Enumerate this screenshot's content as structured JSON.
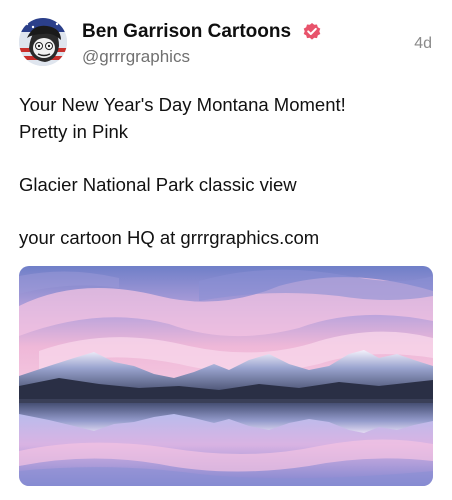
{
  "post": {
    "author": {
      "name": "Ben Garrison Cartoons",
      "handle": "@grrrgraphics",
      "verified": true,
      "avatar_icon": "cartoon-avatar-icon"
    },
    "timestamp": "4d",
    "text_lines": [
      "Your New Year's Day Montana Moment!",
      "Pretty in Pink",
      "",
      "Glacier National Park classic view",
      "",
      "your cartoon HQ at grrrgraphics.com"
    ],
    "media": {
      "type": "image",
      "icon": "mountain-lake-photo"
    }
  },
  "colors": {
    "verified_badge": "#e8536b",
    "handle_text": "#707070",
    "timestamp_text": "#8a8a8a",
    "sky_pink": "#e9b3d8",
    "sky_blue": "#7c7fc6"
  }
}
